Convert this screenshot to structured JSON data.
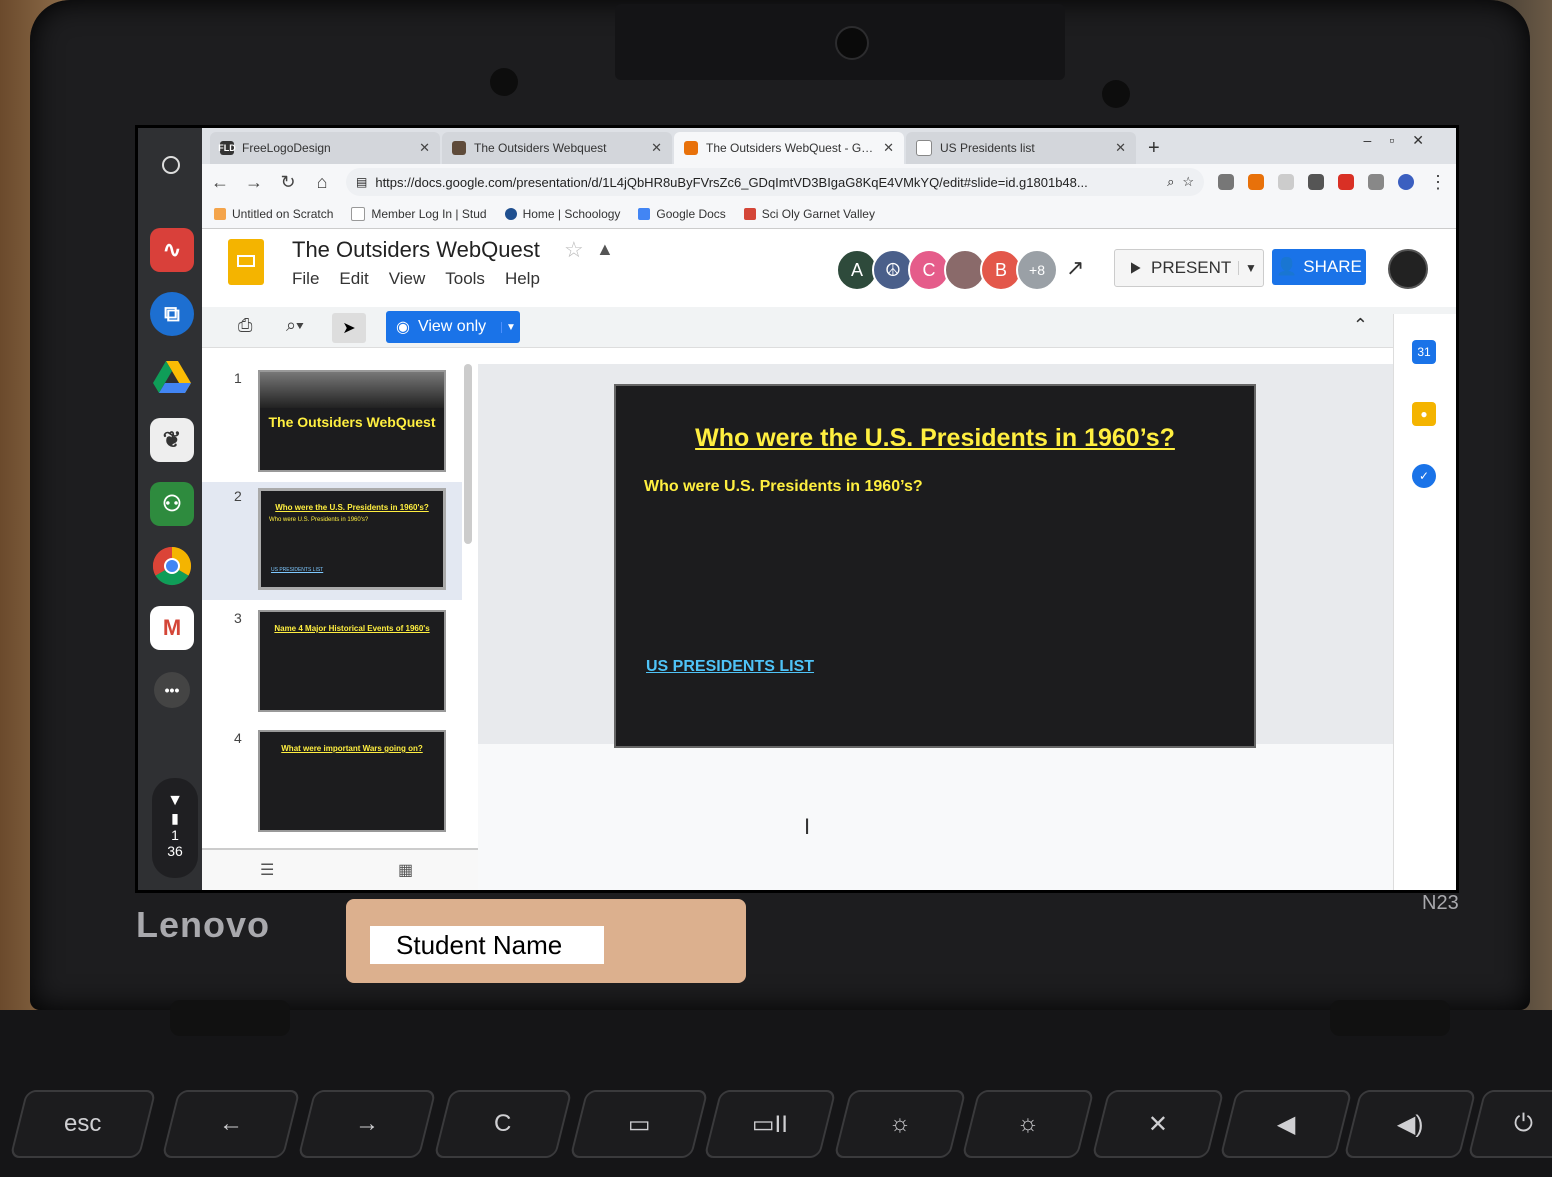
{
  "browser": {
    "tabs": [
      {
        "title": "FreeLogoDesign",
        "favicon_color": "#333333",
        "favicon_text": "FLD",
        "active": false
      },
      {
        "title": "The Outsiders Webquest",
        "favicon_color": "#5f4b3a",
        "favicon_text": "",
        "active": false
      },
      {
        "title": "The Outsiders WebQuest - Googl",
        "favicon_color": "#e8710a",
        "favicon_text": "",
        "active": true
      },
      {
        "title": "US Presidents list",
        "favicon_color": "#888888",
        "favicon_text": "",
        "active": false
      }
    ],
    "new_tab_label": "+",
    "url": "https://docs.google.com/presentation/d/1L4jQbHR8uByFVrsZc6_GDqImtVD3BIgaG8KqE4VMkYQ/edit#slide=id.g1801b48...",
    "bookmarks": [
      {
        "label": "Untitled on Scratch",
        "color": "#f4a44b"
      },
      {
        "label": "Member Log In | Stud",
        "color": "#999999"
      },
      {
        "label": "Home | Schoology",
        "color": "#1f4f8f"
      },
      {
        "label": "Google Docs",
        "color": "#4285f4"
      },
      {
        "label": "Sci Oly Garnet Valley",
        "color": "#d44638"
      }
    ]
  },
  "docs": {
    "title": "The Outsiders WebQuest",
    "menu": [
      "File",
      "Edit",
      "View",
      "Tools",
      "Help"
    ],
    "collaborators": [
      {
        "initial": "A",
        "color": "#2e4a3b"
      },
      {
        "initial": "☮",
        "color": "#4a5f8a"
      },
      {
        "initial": "C",
        "color": "#e55c8a"
      },
      {
        "initial": "",
        "color": "#8a6a6a"
      },
      {
        "initial": "B",
        "color": "#e3574a"
      },
      {
        "initial": "+8",
        "color": "#9aa0a6"
      }
    ],
    "present_label": "PRESENT",
    "share_label": "SHARE",
    "view_only_label": "View only"
  },
  "filmstrip": [
    {
      "num": "1",
      "title": "The Outsiders WebQuest",
      "sub": "",
      "link": ""
    },
    {
      "num": "2",
      "title": "Who were the U.S. Presidents in 1960's?",
      "sub": "Who were U.S. Presidents in 1960's?",
      "link": "US PRESIDENTS LIST"
    },
    {
      "num": "3",
      "title": "Name 4 Major Historical Events of 1960's",
      "sub": "",
      "link": ""
    },
    {
      "num": "4",
      "title": "What were important Wars going on?",
      "sub": "",
      "link": ""
    }
  ],
  "slide": {
    "title": "Who were the  U.S. Presidents in 1960’s?",
    "body": "Who were U.S. Presidents in 1960’s?",
    "link": "US PRESIDENTS LIST"
  },
  "shelf": {
    "status_top": "1",
    "status_bottom": "36"
  },
  "laptop": {
    "brand": "Lenovo",
    "model": "N23"
  },
  "overlay": {
    "name_label": "Student Name"
  },
  "keys": [
    "esc",
    "←",
    "→",
    "C",
    "▭",
    "▭II",
    "☼",
    "☼",
    "✕",
    "◀",
    "◀)",
    "⏻"
  ]
}
